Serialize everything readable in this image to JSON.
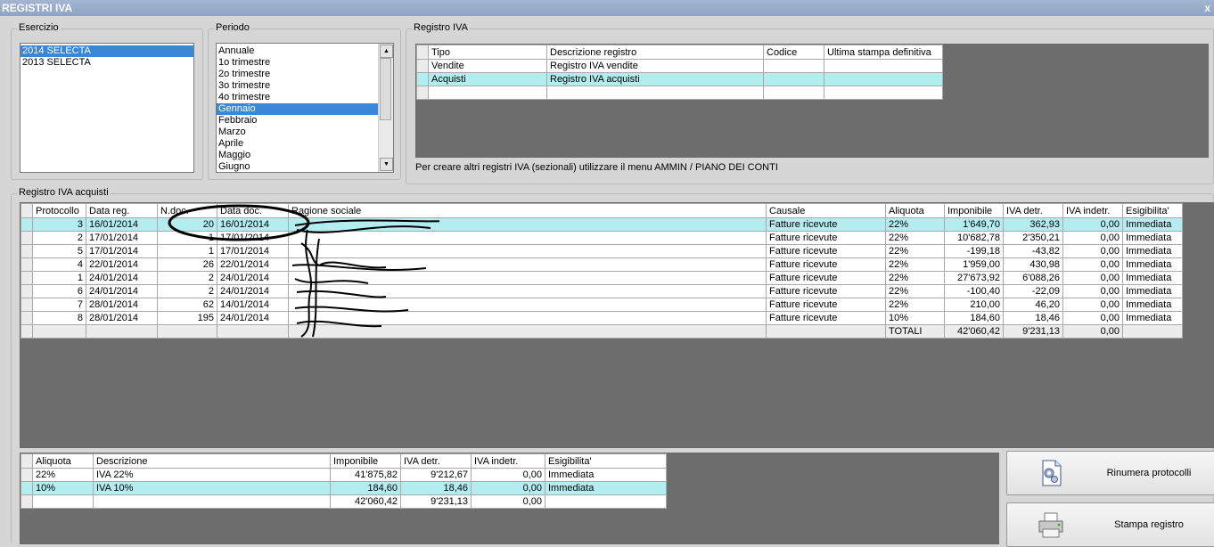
{
  "window": {
    "title": "REGISTRI IVA",
    "close": "x"
  },
  "esercizio": {
    "label": "Esercizio",
    "items": [
      "2014 SELECTA",
      "2013 SELECTA"
    ],
    "selected": 0
  },
  "periodo": {
    "label": "Periodo",
    "items": [
      "Annuale",
      "1o trimestre",
      "2o trimestre",
      "3o trimestre",
      "4o trimestre",
      "Gennaio",
      "Febbraio",
      "Marzo",
      "Aprile",
      "Maggio",
      "Giugno"
    ],
    "selected": 5
  },
  "registro_iva": {
    "label": "Registro IVA",
    "columns": [
      "Tipo",
      "Descrizione registro",
      "Codice",
      "Ultima stampa definitiva"
    ],
    "rows": [
      [
        "Vendite",
        "Registro IVA vendite",
        "",
        ""
      ],
      [
        "Acquisti",
        "Registro IVA acquisti",
        "",
        ""
      ],
      [
        "",
        "",
        "",
        ""
      ]
    ],
    "selected": 1,
    "hint": "Per creare altri registri IVA (sezionali) utilizzare il menu AMMIN / PIANO DEI CONTI"
  },
  "acquisti": {
    "label": "Registro IVA acquisti",
    "columns": [
      "Protocollo",
      "Data reg.",
      "N.doc.",
      "Data doc.",
      "Ragione sociale",
      "Causale",
      "Aliquota",
      "Imponibile",
      "IVA detr.",
      "IVA indetr.",
      "Esigibilita'"
    ],
    "rows": [
      [
        "3",
        "16/01/2014",
        "20",
        "16/01/2014",
        "",
        "Fatture ricevute",
        "22%",
        "1'649,70",
        "362,93",
        "0,00",
        "Immediata"
      ],
      [
        "2",
        "17/01/2014",
        "1",
        "17/01/2014",
        "",
        "Fatture ricevute",
        "22%",
        "10'682,78",
        "2'350,21",
        "0,00",
        "Immediata"
      ],
      [
        "5",
        "17/01/2014",
        "1",
        "17/01/2014",
        "",
        "Fatture ricevute",
        "22%",
        "-199,18",
        "-43,82",
        "0,00",
        "Immediata"
      ],
      [
        "4",
        "22/01/2014",
        "26",
        "22/01/2014",
        "",
        "Fatture ricevute",
        "22%",
        "1'959,00",
        "430,98",
        "0,00",
        "Immediata"
      ],
      [
        "1",
        "24/01/2014",
        "2",
        "24/01/2014",
        "",
        "Fatture ricevute",
        "22%",
        "27'673,92",
        "6'088,26",
        "0,00",
        "Immediata"
      ],
      [
        "6",
        "24/01/2014",
        "2",
        "24/01/2014",
        "",
        "Fatture ricevute",
        "22%",
        "-100,40",
        "-22,09",
        "0,00",
        "Immediata"
      ],
      [
        "7",
        "28/01/2014",
        "62",
        "14/01/2014",
        "",
        "Fatture ricevute",
        "22%",
        "210,00",
        "46,20",
        "0,00",
        "Immediata"
      ],
      [
        "8",
        "28/01/2014",
        "195",
        "24/01/2014",
        "",
        "Fatture ricevute",
        "10%",
        "184,60",
        "18,46",
        "0,00",
        "Immediata"
      ]
    ],
    "selected": 0,
    "totals": {
      "label": "TOTALI",
      "imponibile": "42'060,42",
      "iva_detr": "9'231,13",
      "iva_indetr": "0,00"
    }
  },
  "riepilogo": {
    "columns": [
      "Aliquota",
      "Descrizione",
      "Imponibile",
      "IVA detr.",
      "IVA indetr.",
      "Esigibilita'"
    ],
    "rows": [
      [
        "22%",
        "IVA 22%",
        "41'875,82",
        "9'212,67",
        "0,00",
        "Immediata"
      ],
      [
        "10%",
        "IVA 10%",
        "184,60",
        "18,46",
        "0,00",
        "Immediata"
      ],
      [
        "",
        "",
        "42'060,42",
        "9'231,13",
        "0,00",
        ""
      ]
    ],
    "selected": 1
  },
  "buttons": {
    "rinumera": "Rinumera protocolli",
    "stampa": "Stampa registro"
  },
  "icons": {
    "rinumera": "gear-document-icon",
    "stampa": "printer-icon"
  },
  "colors": {
    "selection_row": "#b2eeef",
    "list_selection": "#3a86d8",
    "grid_bg": "#6d6d6d"
  }
}
